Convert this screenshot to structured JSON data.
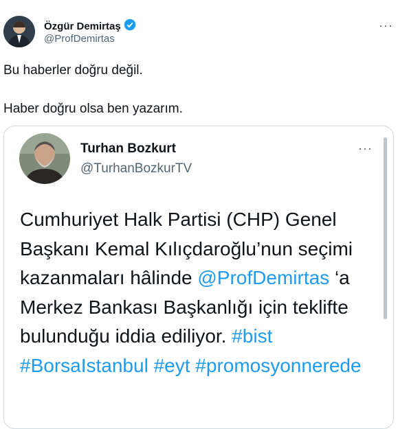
{
  "tweet": {
    "author_name": "Özgür Demirtaş",
    "author_handle": "@ProfDemirtas",
    "more_label": "···",
    "line1": "Bu haberler doğru değil.",
    "line2": "Haber doğru olsa ben yazarım."
  },
  "quote": {
    "author_name": "Turhan Bozkurt",
    "author_handle": "@TurhanBozkurTV",
    "more_label": "···",
    "text": {
      "part1": "Cumhuriyet Halk Partisi (CHP) Genel Başkanı Kemal Kılıçdaroğlu’nun seçimi kazanmaları hâlinde ",
      "mention": "@ProfDemirtas",
      "part2": " ‘a Merkez Bankası Başkanlığı için teklifte bulunduğu iddia ediliyor. ",
      "hashtags": [
        "#bist",
        "#BorsaIstanbul",
        "#eyt",
        "#promosyonnerede"
      ]
    }
  },
  "colors": {
    "link": "#1d9bf0",
    "verified": "#1d9bf0",
    "secondary_text": "#536471",
    "border": "#cfd9de"
  },
  "icons": {
    "verified": "verified-badge-icon",
    "more": "more-icon"
  }
}
